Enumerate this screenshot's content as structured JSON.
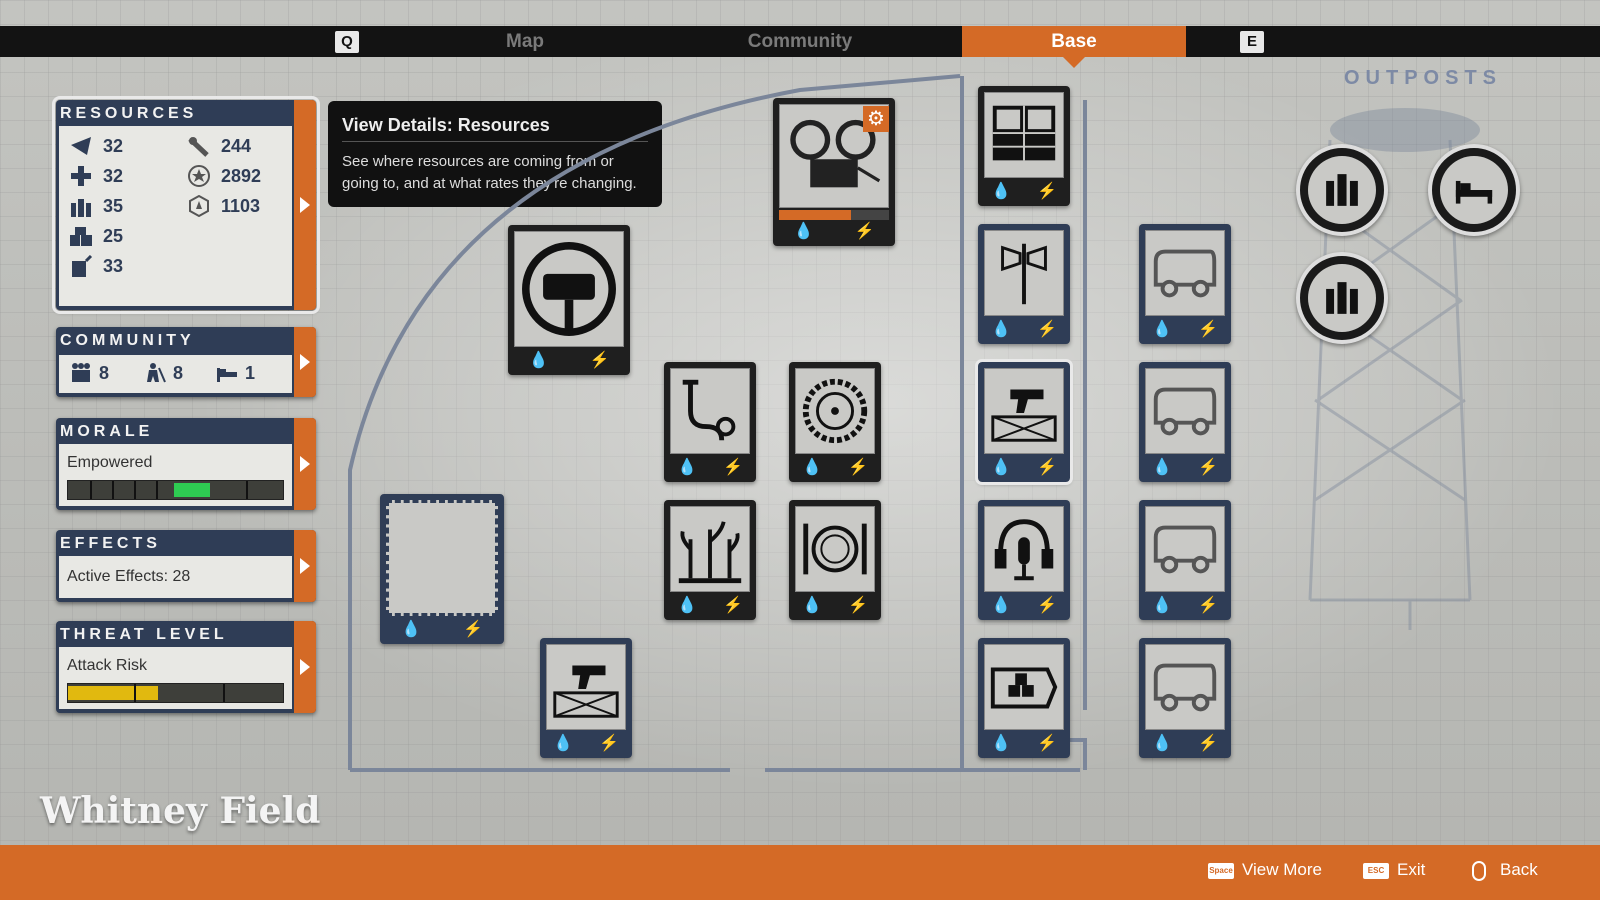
{
  "top_nav": {
    "left_key": "Q",
    "right_key": "E",
    "tabs": [
      {
        "label": "Map"
      },
      {
        "label": "Community"
      },
      {
        "label": "Base"
      }
    ]
  },
  "panels": {
    "resources": {
      "title": "RESOURCES",
      "left": [
        {
          "icon": "food-icon",
          "value": "32"
        },
        {
          "icon": "medicine-icon",
          "value": "32"
        },
        {
          "icon": "ammo-icon",
          "value": "35"
        },
        {
          "icon": "materials-icon",
          "value": "25"
        },
        {
          "icon": "fuel-icon",
          "value": "33"
        }
      ],
      "right": [
        {
          "icon": "rations-icon",
          "value": "244"
        },
        {
          "icon": "influence-icon",
          "value": "2892"
        },
        {
          "icon": "prestige-icon",
          "value": "1103"
        }
      ]
    },
    "community": {
      "title": "COMMUNITY",
      "survivors": "8",
      "labor": "8",
      "beds": "1"
    },
    "morale": {
      "title": "MORALE",
      "label": "Empowered",
      "level": 0.55
    },
    "effects": {
      "title": "EFFECTS",
      "label": "Active Effects: 28"
    },
    "threat": {
      "title": "THREAT LEVEL",
      "label": "Attack Risk",
      "level": 0.4
    }
  },
  "tooltip": {
    "title": "View Details: Resources",
    "body": "See where resources are coming from or going to, and at what rates they're changing."
  },
  "outposts": {
    "title": "OUTPOSTS"
  },
  "base_name": "Whitney Field",
  "footer": {
    "view_more_key": "Space",
    "view_more": "View More",
    "exit_key": "ESC",
    "exit": "Exit",
    "back": "Back"
  },
  "colors": {
    "accent": "#d46a26",
    "panel": "#2f3d56",
    "morale_green": "#2ecc52",
    "threat_yellow": "#e1b90f"
  }
}
